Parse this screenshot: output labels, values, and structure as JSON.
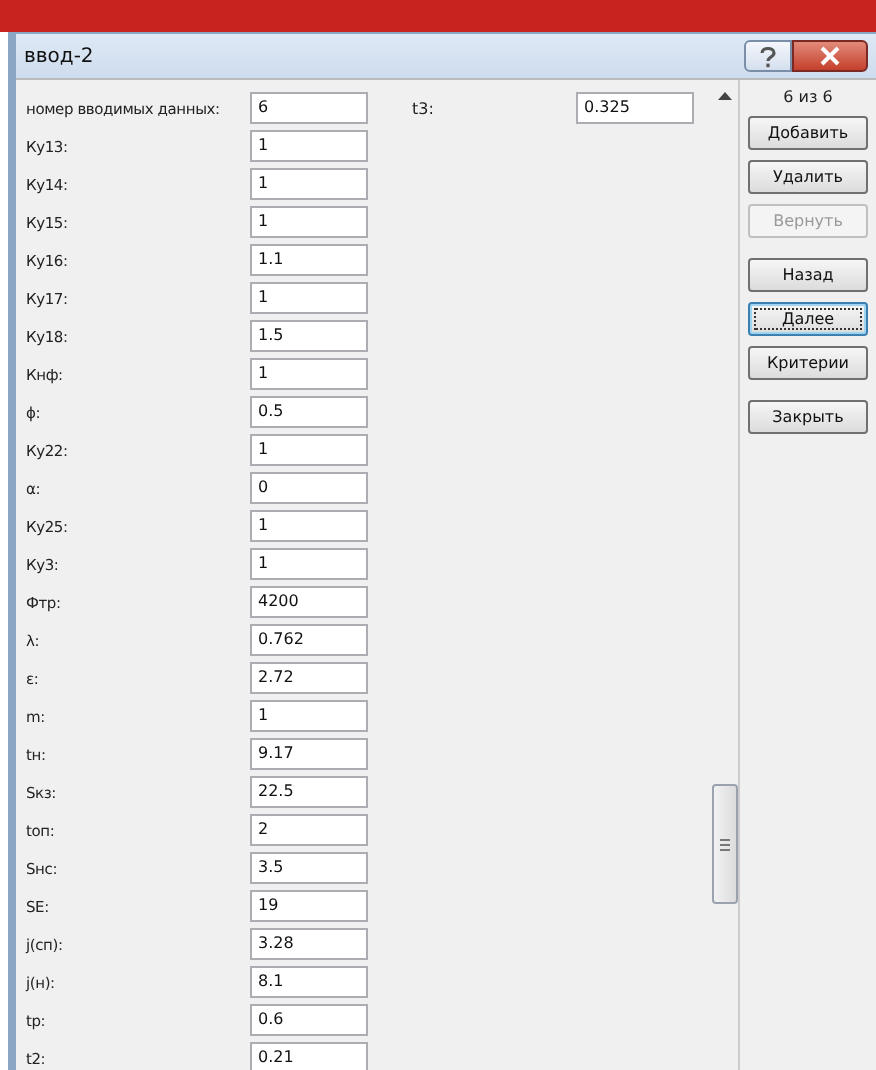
{
  "window": {
    "title": "ввод-2"
  },
  "fields": [
    {
      "label": "номер вводимых данных:",
      "value": "6"
    },
    {
      "label": "Ку13:",
      "value": "1"
    },
    {
      "label": "Ку14:",
      "value": "1"
    },
    {
      "label": "Ку15:",
      "value": "1"
    },
    {
      "label": "Ку16:",
      "value": "1.1"
    },
    {
      "label": "Ку17:",
      "value": "1"
    },
    {
      "label": "Ку18:",
      "value": "1.5"
    },
    {
      "label": "Кнф:",
      "value": "1"
    },
    {
      "label": "ϕ:",
      "value": "0.5"
    },
    {
      "label": "Ку22:",
      "value": "1"
    },
    {
      "label": "α:",
      "value": "0"
    },
    {
      "label": "Ку25:",
      "value": "1"
    },
    {
      "label": "Ку3:",
      "value": "1"
    },
    {
      "label": "Фтр:",
      "value": "4200"
    },
    {
      "label": "λ:",
      "value": "0.762"
    },
    {
      "label": "ε:",
      "value": "2.72"
    },
    {
      "label": "m:",
      "value": "1"
    },
    {
      "label": "tн:",
      "value": "9.17"
    },
    {
      "label": "Sкз:",
      "value": "22.5"
    },
    {
      "label": "tоп:",
      "value": "2"
    },
    {
      "label": "Sнс:",
      "value": "3.5"
    },
    {
      "label": "SE:",
      "value": "19"
    },
    {
      "label": "j(сп):",
      "value": "3.28"
    },
    {
      "label": "j(н):",
      "value": "8.1"
    },
    {
      "label": "tр:",
      "value": "0.6"
    },
    {
      "label": "t2:",
      "value": "0.21"
    }
  ],
  "side_field": {
    "label": "t3:",
    "value": "0.325"
  },
  "record_counter": "6 из 6",
  "button_groups": [
    [
      {
        "label": "Добавить",
        "disabled": false,
        "focused": false
      },
      {
        "label": "Удалить",
        "disabled": false,
        "focused": false
      },
      {
        "label": "Вернуть",
        "disabled": true,
        "focused": false
      }
    ],
    [
      {
        "label": "Назад",
        "disabled": false,
        "focused": false
      },
      {
        "label": "Далее",
        "disabled": false,
        "focused": true
      },
      {
        "label": "Критерии",
        "disabled": false,
        "focused": false
      }
    ],
    [
      {
        "label": "Закрыть",
        "disabled": false,
        "focused": false
      }
    ]
  ]
}
